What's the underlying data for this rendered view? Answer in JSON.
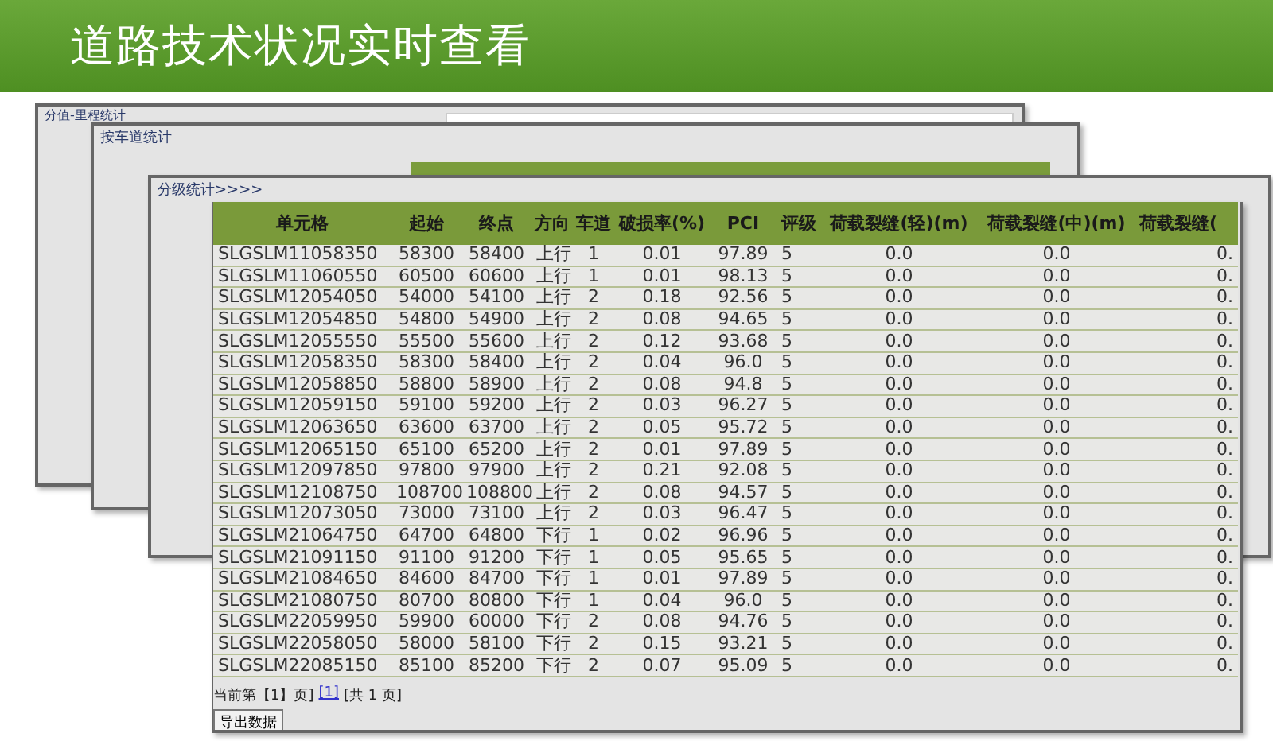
{
  "banner": {
    "title": "道路技术状况实时查看"
  },
  "panels": [
    {
      "title": "分值-里程统计",
      "kind": "whitebox"
    },
    {
      "title": "按车道统计",
      "kind": "greenbar"
    },
    {
      "title": "分级统计>>>>",
      "kind": "plain"
    }
  ],
  "table": {
    "columns": [
      "单元格",
      "起始",
      "终点",
      "方向",
      "车道",
      "破损率(%)",
      "PCI",
      "评级",
      "荷载裂缝(轻)(m)",
      "荷载裂缝(中)(m)",
      "荷载裂缝("
    ],
    "rows": [
      [
        "SLGSLM11058350",
        "58300",
        "58400",
        "上行",
        "1",
        "0.01",
        "97.89",
        "5",
        "0.0",
        "0.0",
        "0."
      ],
      [
        "SLGSLM11060550",
        "60500",
        "60600",
        "上行",
        "1",
        "0.01",
        "98.13",
        "5",
        "0.0",
        "0.0",
        "0."
      ],
      [
        "SLGSLM12054050",
        "54000",
        "54100",
        "上行",
        "2",
        "0.18",
        "92.56",
        "5",
        "0.0",
        "0.0",
        "0."
      ],
      [
        "SLGSLM12054850",
        "54800",
        "54900",
        "上行",
        "2",
        "0.08",
        "94.65",
        "5",
        "0.0",
        "0.0",
        "0."
      ],
      [
        "SLGSLM12055550",
        "55500",
        "55600",
        "上行",
        "2",
        "0.12",
        "93.68",
        "5",
        "0.0",
        "0.0",
        "0."
      ],
      [
        "SLGSLM12058350",
        "58300",
        "58400",
        "上行",
        "2",
        "0.04",
        "96.0",
        "5",
        "0.0",
        "0.0",
        "0."
      ],
      [
        "SLGSLM12058850",
        "58800",
        "58900",
        "上行",
        "2",
        "0.08",
        "94.8",
        "5",
        "0.0",
        "0.0",
        "0."
      ],
      [
        "SLGSLM12059150",
        "59100",
        "59200",
        "上行",
        "2",
        "0.03",
        "96.27",
        "5",
        "0.0",
        "0.0",
        "0."
      ],
      [
        "SLGSLM12063650",
        "63600",
        "63700",
        "上行",
        "2",
        "0.05",
        "95.72",
        "5",
        "0.0",
        "0.0",
        "0."
      ],
      [
        "SLGSLM12065150",
        "65100",
        "65200",
        "上行",
        "2",
        "0.01",
        "97.89",
        "5",
        "0.0",
        "0.0",
        "0."
      ],
      [
        "SLGSLM12097850",
        "97800",
        "97900",
        "上行",
        "2",
        "0.21",
        "92.08",
        "5",
        "0.0",
        "0.0",
        "0."
      ],
      [
        "SLGSLM12108750",
        "108700",
        "108800",
        "上行",
        "2",
        "0.08",
        "94.57",
        "5",
        "0.0",
        "0.0",
        "0."
      ],
      [
        "SLGSLM12073050",
        "73000",
        "73100",
        "上行",
        "2",
        "0.03",
        "96.47",
        "5",
        "0.0",
        "0.0",
        "0."
      ],
      [
        "SLGSLM21064750",
        "64700",
        "64800",
        "下行",
        "1",
        "0.02",
        "96.96",
        "5",
        "0.0",
        "0.0",
        "0."
      ],
      [
        "SLGSLM21091150",
        "91100",
        "91200",
        "下行",
        "1",
        "0.05",
        "95.65",
        "5",
        "0.0",
        "0.0",
        "0."
      ],
      [
        "SLGSLM21084650",
        "84600",
        "84700",
        "下行",
        "1",
        "0.01",
        "97.89",
        "5",
        "0.0",
        "0.0",
        "0."
      ],
      [
        "SLGSLM21080750",
        "80700",
        "80800",
        "下行",
        "1",
        "0.04",
        "96.0",
        "5",
        "0.0",
        "0.0",
        "0."
      ],
      [
        "SLGSLM22059950",
        "59900",
        "60000",
        "下行",
        "2",
        "0.08",
        "94.76",
        "5",
        "0.0",
        "0.0",
        "0."
      ],
      [
        "SLGSLM22058050",
        "58000",
        "58100",
        "下行",
        "2",
        "0.15",
        "93.21",
        "5",
        "0.0",
        "0.0",
        "0."
      ],
      [
        "SLGSLM22085150",
        "85100",
        "85200",
        "下行",
        "2",
        "0.07",
        "95.09",
        "5",
        "0.0",
        "0.0",
        "0."
      ]
    ]
  },
  "pagination": {
    "current": "当前第【1】页]",
    "page_link": "[1]",
    "total": "[共 1 页]"
  },
  "export_button": "导出数据"
}
